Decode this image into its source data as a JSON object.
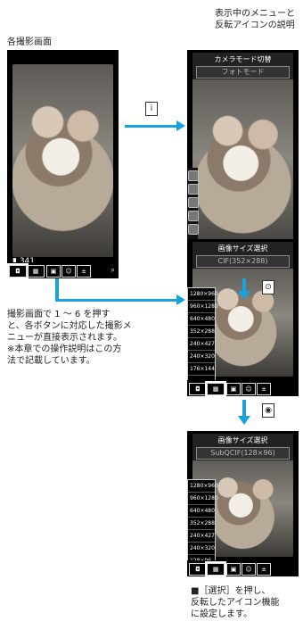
{
  "top_right_caption": [
    "表示中のメニューと",
    "反転アイコンの説明"
  ],
  "top_left_caption": "各撮影画面",
  "left_caption_lines": [
    "撮影画面で 1 ～ 6 を押す",
    "と、各ボタンに対応した撮影メ",
    "ニューが直接表示されます。",
    "※本章での操作説明はこの方",
    "法で記載しています。"
  ],
  "bottom_caption_lines": [
    "■［選択］を押し、",
    "反転したアイコン機能",
    "に設定します。"
  ],
  "phone1": {
    "counter": "341"
  },
  "phone2": {
    "menu_title": "カメラモード切替",
    "menu_value": "フォトモード"
  },
  "phone3": {
    "menu_title": "画像サイズ選択",
    "menu_value": "CIF(352×288)"
  },
  "phone4": {
    "menu_title": "画像サイズ選択",
    "menu_value": "SubQCIF(128×96)"
  },
  "size_list": [
    "1280×960",
    "960×1280",
    "640×480",
    "352×288",
    "240×427",
    "240×320",
    "176×144",
    "128×96"
  ],
  "keys": {
    "k1": "i",
    "k2": "⊙",
    "k3": "◉"
  },
  "colors": {
    "arrow": "#18a1dc",
    "bg": "#000000"
  }
}
